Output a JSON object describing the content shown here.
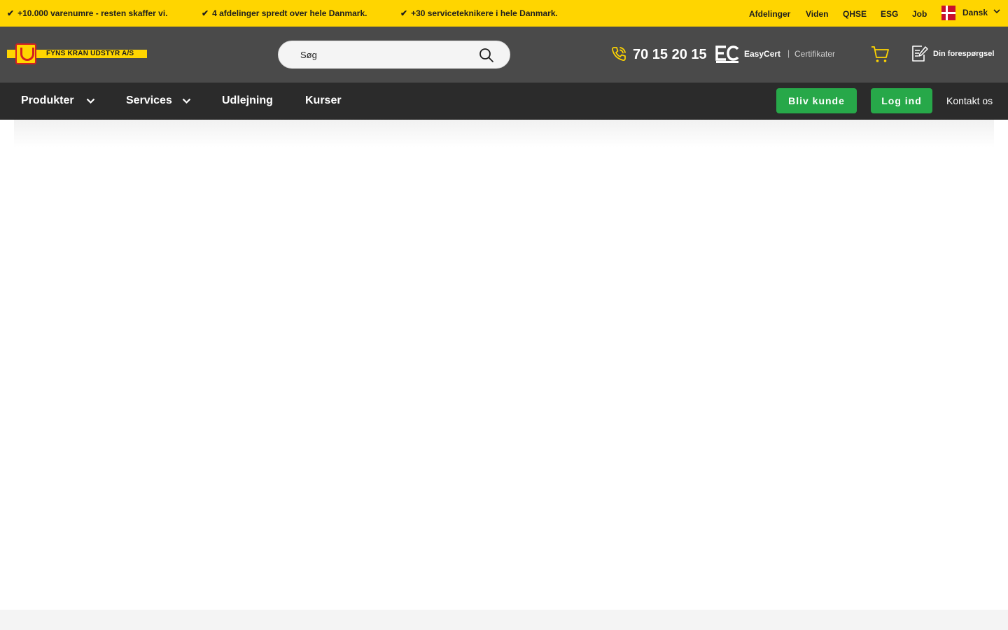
{
  "topbar": {
    "background": "#ffd500",
    "usps": [
      {
        "check": "✔",
        "text": "+10.000 varenumre - resten skaffer vi."
      },
      {
        "check": "✔",
        "text": "4 afdelinger spredt over hele Danmark."
      },
      {
        "check": "✔",
        "text": "+30 serviceteknikere i hele Danmark."
      }
    ],
    "links": [
      "Afdelinger",
      "Viden",
      "QHSE",
      "ESG",
      "Job"
    ],
    "language": {
      "label": "Dansk",
      "flag": "denmark-flag-icon",
      "icon": "chevron-down-icon"
    }
  },
  "header": {
    "background": "#4a4a4a",
    "logo_text": "FYNS KRAN UDSTYR A/S",
    "search": {
      "placeholder": "Søg",
      "icon": "search-icon"
    },
    "phone": {
      "icon": "phone-icon",
      "number": "70 15 20 15"
    },
    "easycert": {
      "icon": "easycert-logo-icon",
      "name": "EasyCert",
      "separator": "|",
      "link": "Certifikater"
    },
    "cart": {
      "icon": "cart-icon"
    },
    "inquiry": {
      "icon": "inquiry-document-icon",
      "label": "Din forespørgsel"
    }
  },
  "nav": {
    "background": "#2b2b2b",
    "items": [
      {
        "label": "Produkter",
        "has_dropdown": true
      },
      {
        "label": "Services",
        "has_dropdown": true
      },
      {
        "label": "Udlejning",
        "has_dropdown": false
      },
      {
        "label": "Kurser",
        "has_dropdown": false
      }
    ],
    "buttons": {
      "become_customer": "Bliv kunde",
      "login": "Log ind"
    },
    "contact": "Kontakt os",
    "button_color": "#27a849"
  },
  "accent_color": "#ffd500"
}
